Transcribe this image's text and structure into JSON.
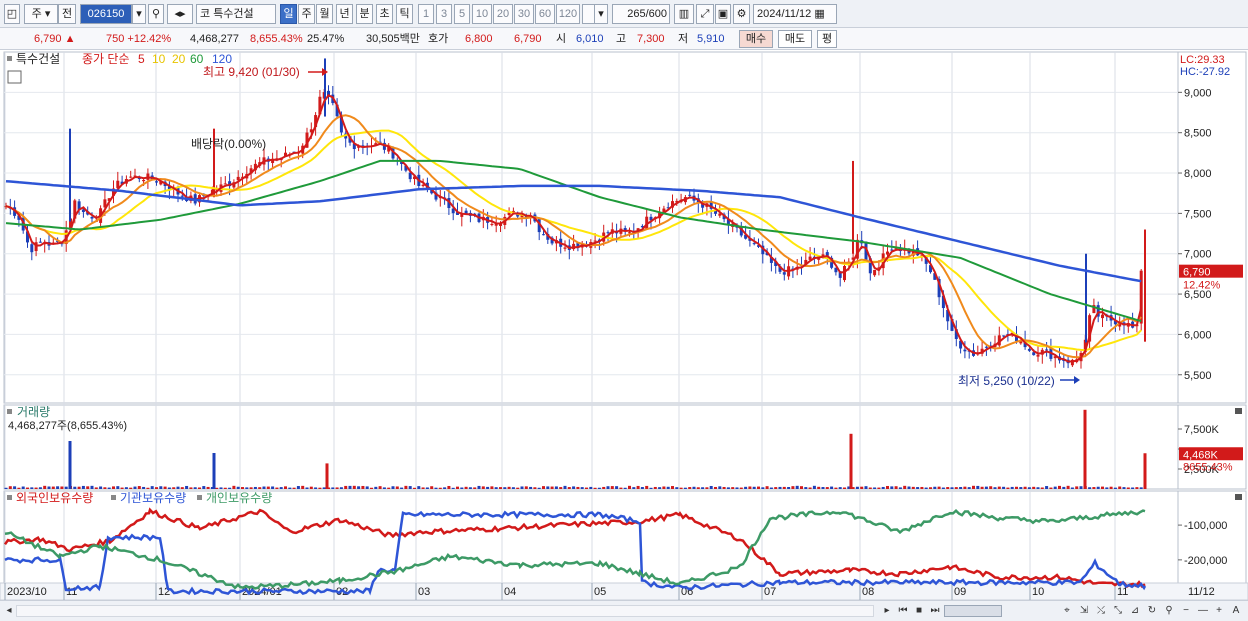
{
  "toolbar": {
    "market": "주",
    "prev": "전",
    "code": "026150",
    "stock_name": "특수건설",
    "market_tag": "코",
    "periods": [
      "일",
      "주",
      "월",
      "년",
      "분",
      "초",
      "틱"
    ],
    "selected_period": "일",
    "intervals": [
      "1",
      "3",
      "5",
      "10",
      "20",
      "30",
      "60",
      "120"
    ],
    "count": "265",
    "count_total": "/600",
    "date": "2024/11/12"
  },
  "quote": {
    "price": "6,790",
    "arrow": "▲",
    "change": "750",
    "change_pct": "+12.42%",
    "volume": "4,468,277",
    "volume_pct": "8,655.43%",
    "turnover_pct": "25.47%",
    "amount": "30,505백만",
    "bid_label": "호가",
    "bid1": "6,800",
    "bid2": "6,790",
    "open_label": "시",
    "open": "6,010",
    "high_label": "고",
    "high": "7,300",
    "low_label": "저",
    "low": "5,910",
    "buy_label": "매수",
    "sell_label": "매도",
    "flat_label": "평"
  },
  "price_panel": {
    "title": "특수건설",
    "ma_label": "종가 단순",
    "ma_periods": [
      "5",
      "10",
      "20",
      "60",
      "120"
    ],
    "lc": "LC:29.33",
    "hc": "HC:-27.92",
    "high_note": "최고 9,420 (01/30)",
    "low_note": "최저 5,250 (10/22)",
    "dividend_note": "배당락(0.00%)",
    "last_price_tag": "6,790",
    "last_pct_tag": "12.42%"
  },
  "volume_panel": {
    "title": "거래량",
    "value": "4,468,277주(8,655.43%)",
    "axis_ticks": [
      "7,500K",
      "5,000K",
      "2,500K"
    ],
    "last_tag": "4,468K",
    "last_pct_tag": "8655.43%"
  },
  "holding_panel": {
    "legend": [
      "외국인보유수량",
      "기관보유수량",
      "개인보유수량"
    ],
    "axis_ticks": [
      "-100,000",
      "-200,000"
    ]
  },
  "x_axis": {
    "labels": [
      "2023/10",
      "11",
      "12",
      "2024/01",
      "02",
      "03",
      "04",
      "05",
      "06",
      "07",
      "08",
      "09",
      "10",
      "11"
    ],
    "end_label": "11/12"
  },
  "colors": {
    "up": "#d21a1a",
    "down": "#1c3fb8",
    "ma5": "#d21a1a",
    "ma10": "#f08a1c",
    "ma20": "#ffe60a",
    "ma60": "#1f9a3a",
    "ma120": "#2e55d6",
    "foreign": "#d21a1a",
    "institution": "#2e55d6",
    "individual": "#3d9a66"
  },
  "chart_data": [
    {
      "type": "candlestick",
      "title": "특수건설",
      "y_ticks": [
        5500,
        6000,
        6500,
        7000,
        7500,
        8000,
        8500,
        9000
      ],
      "ylim": [
        5150,
        9500
      ],
      "x_labels": [
        "2023/10",
        "11",
        "12",
        "2024/01",
        "02",
        "03",
        "04",
        "05",
        "06",
        "07",
        "08",
        "09",
        "10",
        "11"
      ],
      "last_close": 6790,
      "annotations": [
        {
          "text": "최고 9,420 (01/30)",
          "value": 9420
        },
        {
          "text": "최저 5,250 (10/22)",
          "value": 5250
        }
      ],
      "series": [
        {
          "name": "종가",
          "months": [
            "2023/10",
            "11",
            "12",
            "2024/01",
            "02",
            "03",
            "04",
            "05",
            "06",
            "07",
            "08",
            "09",
            "10",
            "11"
          ],
          "approx_close": [
            7150,
            7900,
            8000,
            8200,
            8300,
            7700,
            7300,
            7200,
            7700,
            6800,
            7000,
            5900,
            5700,
            6790
          ]
        },
        {
          "name": "5",
          "approx_last": 6100
        },
        {
          "name": "10",
          "approx_last": 6050
        },
        {
          "name": "20",
          "approx_last": 6000
        },
        {
          "name": "60",
          "approx_last": 6150
        },
        {
          "name": "120",
          "approx_last": 6650
        }
      ]
    },
    {
      "type": "bar",
      "title": "거래량",
      "y_ticks": [
        2500,
        5000,
        7500
      ],
      "unit": "K",
      "last_value": 4468277,
      "spikes": [
        {
          "month": "11",
          "value": 6000000
        },
        {
          "month": "12",
          "value": 4500000
        },
        {
          "month": "02",
          "value": 3200000
        },
        {
          "month": "08",
          "value": 6900000
        },
        {
          "month": "11",
          "value": 9900000
        },
        {
          "month": "11/12",
          "value": 4468277
        }
      ]
    },
    {
      "type": "line",
      "y_ticks": [
        -100000,
        -200000
      ],
      "series": [
        {
          "name": "외국인보유수량"
        },
        {
          "name": "기관보유수량"
        },
        {
          "name": "개인보유수량"
        }
      ]
    }
  ]
}
